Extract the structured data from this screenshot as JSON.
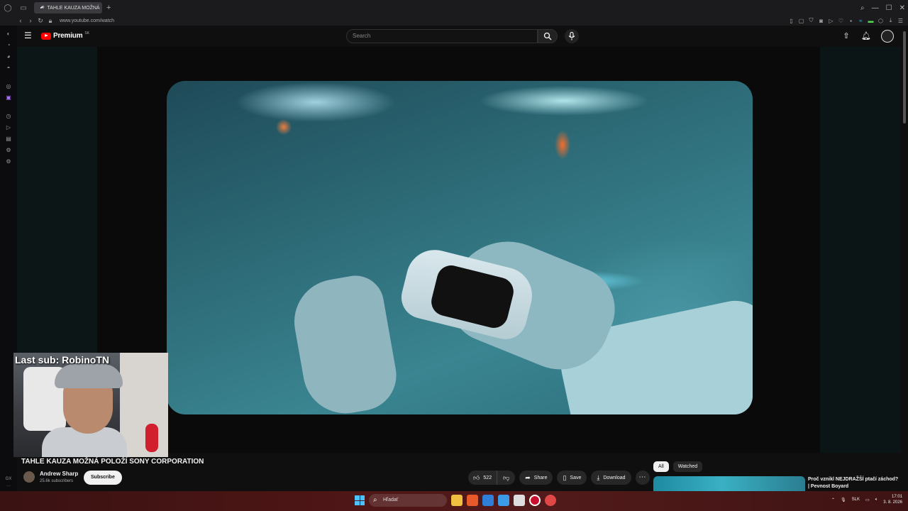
{
  "browser": {
    "tab_title": "TAHLE KAUZA MOŽNÁ",
    "url": "www.youtube.com/watch",
    "sidebar_bottom_label": "GX"
  },
  "youtube": {
    "logo_text": "Premium",
    "logo_sup": "SK",
    "search_placeholder": "Search"
  },
  "webcam": {
    "overlay_text": "Last sub: RobinoTN"
  },
  "video": {
    "title": "TAHLE KAUZA MOŽNÁ POLOŽÍ SONY CORPORATION",
    "channel_name": "Andrew Sharp",
    "subscribers": "25.6k subscribers",
    "subscribe_label": "Subscribe",
    "likes": "522",
    "share_label": "Share",
    "save_label": "Save",
    "download_label": "Download"
  },
  "related": {
    "chips": [
      "All",
      "Watched"
    ],
    "first_title": "Proč vznikl NEJDRAŽŠÍ ptačí záchod? | Pevnost Boyard"
  },
  "taskbar": {
    "search_placeholder": "Hľadať",
    "language": "SLK",
    "time": "17:01",
    "date": "3. 8. 2026"
  }
}
